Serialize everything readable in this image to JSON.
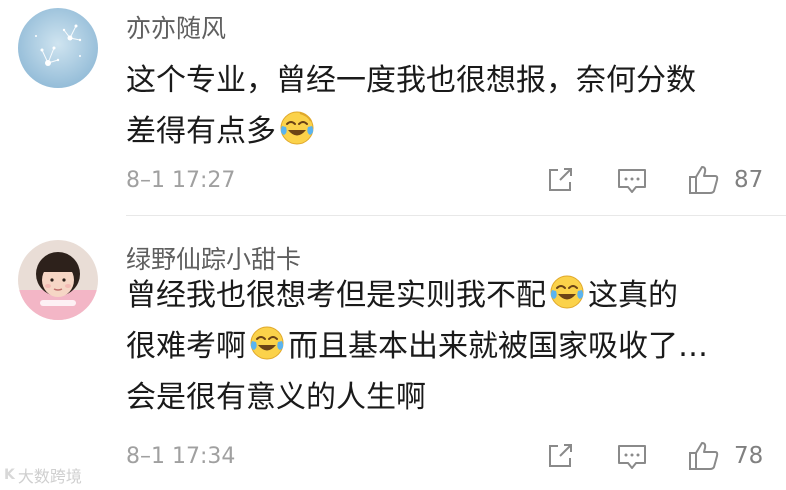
{
  "comments": [
    {
      "username": "亦亦随风",
      "text_lines": [
        "这个专业，曾经一度我也很想报，奈何分数",
        "差得有点多"
      ],
      "emoji_icon": "crying-laughing-emoji",
      "time": "8–1 17:27",
      "likes": "87"
    },
    {
      "username": "绿野仙踪小甜卡",
      "text_segments": [
        "曾经我也很想考但是实则我不配",
        "这真的",
        "很难考啊",
        "而且基本出来就被国家吸收了…",
        "会是很有意义的人生啊"
      ],
      "emoji_icon": "laughing-tears-emoji",
      "time": "8–1 17:34",
      "likes": "78"
    }
  ],
  "watermark": {
    "logo": "K",
    "text": "大数跨境"
  },
  "icons": {
    "share": "share-icon",
    "reply": "comment-icon",
    "like": "thumbs-up-icon"
  }
}
